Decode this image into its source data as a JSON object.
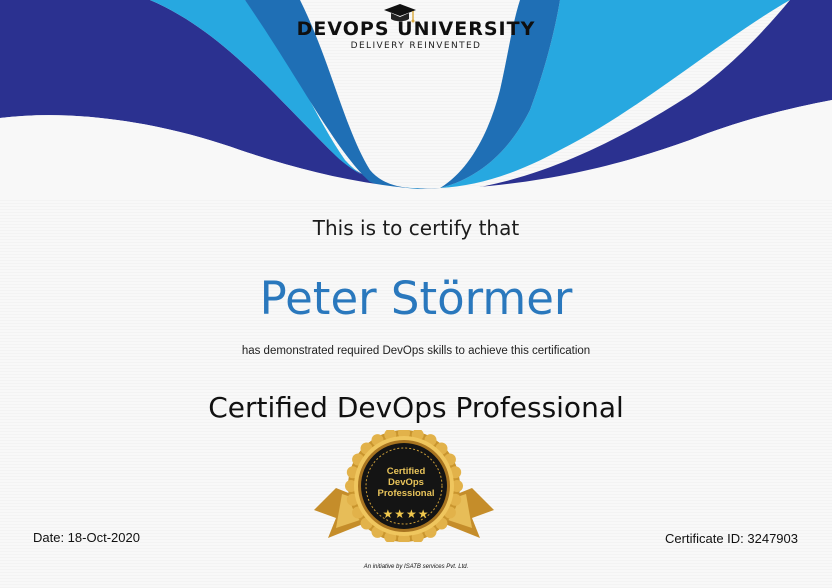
{
  "header": {
    "logo_title": "DEVOPS UNIVERSITY",
    "logo_subtitle": "DELIVERY REINVENTED"
  },
  "certificate": {
    "certify_text": "This is to certify that",
    "recipient_name": "Peter Störmer",
    "description": "has demonstrated required DevOps skills to achieve this certification",
    "course_title": "Certified DevOps Professional",
    "badge_lines": [
      "Certified",
      "DevOps",
      "Professional"
    ],
    "badge_stars": "★★★★",
    "date": "Date: 18-Oct-2020",
    "certificate_id": "Certificate ID: 3247903",
    "footer": "An initiative by ISATB services Pvt. Ltd."
  },
  "colors": {
    "wave_dark": "#2b3190",
    "wave_light": "#27a8e0",
    "wave_mid": "#1f6fb5",
    "name_blue": "#2a78bd",
    "gold": "#d8a73a"
  },
  "icons": [
    "graduation-cap-icon",
    "award-seal-icon"
  ]
}
